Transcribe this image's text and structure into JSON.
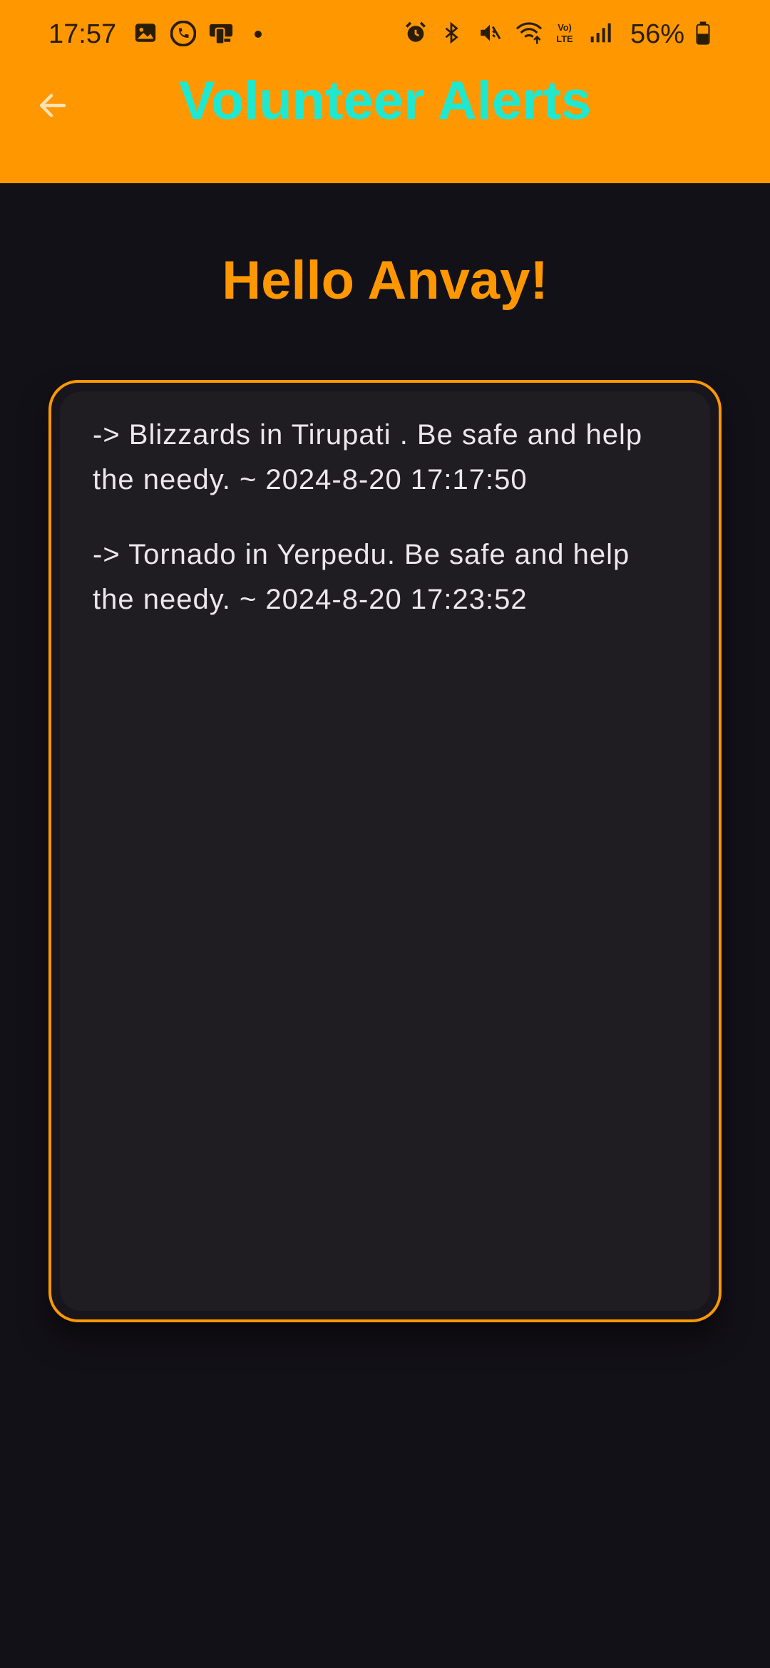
{
  "status_bar": {
    "time": "17:57",
    "battery": "56%",
    "left_icons": [
      "gallery-icon",
      "phone-call-icon",
      "device-icon"
    ],
    "right_icons": [
      "alarm-icon",
      "bluetooth-icon",
      "mute-icon",
      "wifi-icon",
      "volte-icon",
      "signal-icon",
      "battery-icon"
    ]
  },
  "app_bar": {
    "title": "Volunteer Alerts",
    "back_icon": "arrow-left-icon",
    "background": "#FF9800",
    "title_color": "#1DE9D3"
  },
  "greeting": "Hello Anvay!",
  "alerts": [
    {
      "text": "->  Blizzards in Tirupati . Be safe and help the needy. ~ 2024-8-20 17:17:50"
    },
    {
      "text": "->  Tornado in Yerpedu. Be safe and help the needy. ~ 2024-8-20 17:23:52"
    }
  ],
  "colors": {
    "accent": "#FF9800",
    "background": "#131118",
    "card": "#1f1d22",
    "text": "#ECE7EE"
  }
}
